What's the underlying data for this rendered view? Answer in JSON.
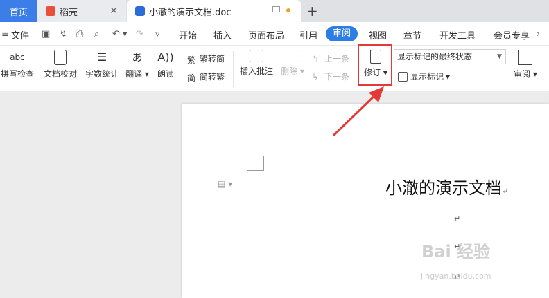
{
  "tabs": {
    "home": "首页",
    "daoke": "稻壳",
    "doc": "小澈的演示文档.doc"
  },
  "menu": {
    "file": "文件",
    "items": [
      "开始",
      "插入",
      "页面布局",
      "引用",
      "审阅",
      "视图",
      "章节",
      "开发工具",
      "会员专享"
    ]
  },
  "ribbon": {
    "spellcheck": "拼写检查",
    "proofread": "文档校对",
    "wordcount": "字数统计",
    "translate": "翻译",
    "read_aloud": "朗读",
    "trad_to_simp": "繁转简",
    "simp_to_trad": "简转繁",
    "insert_comment": "插入批注",
    "delete": "删除",
    "prev": "上一条",
    "next": "下一条",
    "track_changes": "修订",
    "markup_state": "显示标记的最终状态",
    "show_markup": "显示标记",
    "review": "审阅"
  },
  "document": {
    "title": "小澈的演示文档",
    "paragraph_mark": "↵"
  },
  "watermark": {
    "brand": "Bai 经验",
    "url": "jingyan.baidu.com"
  },
  "colors": {
    "accent": "#2d7de6",
    "highlight": "#e53935"
  }
}
